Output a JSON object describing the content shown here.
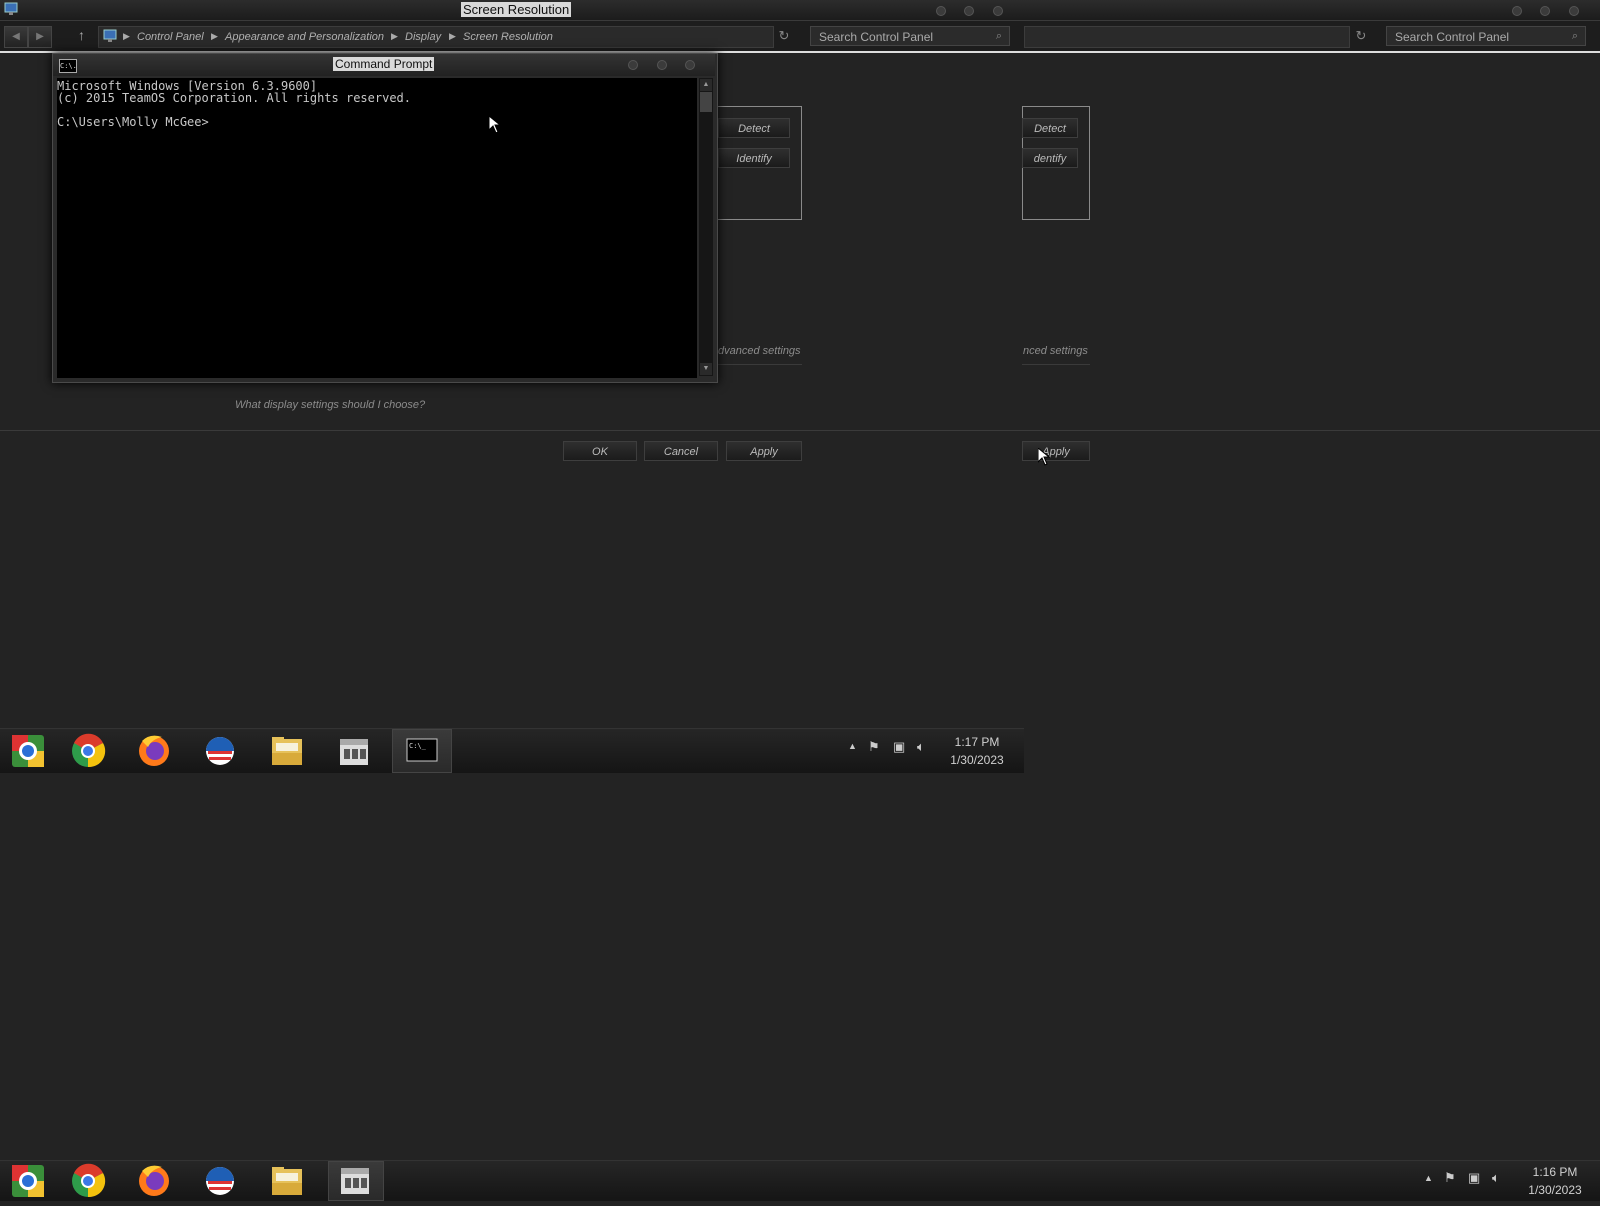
{
  "window": {
    "title": "Screen Resolution"
  },
  "nav": {
    "breadcrumbs": [
      "Control Panel",
      "Appearance and Personalization",
      "Display",
      "Screen Resolution"
    ],
    "search_placeholder": "Search Control Panel",
    "search_placeholder_right": "Search Control Panel"
  },
  "dialog": {
    "detect_label": "Detect",
    "identify_label": "Identify",
    "detect_label_right": "Detect",
    "identify_label_right": "dentify",
    "advanced_link": "dvanced settings",
    "advanced_link_right": "nced settings",
    "help_link": "What display settings should I choose?",
    "ok_label": "OK",
    "cancel_label": "Cancel",
    "apply_label": "Apply",
    "apply_label_right": "Apply"
  },
  "cmd": {
    "title": "Command Prompt",
    "icon_text": "C:\\.",
    "lines": [
      "Microsoft Windows [Version 6.3.9600]",
      "(c) 2015 TeamOS Corporation. All rights reserved.",
      "",
      "C:\\Users\\Molly McGee>"
    ]
  },
  "taskbar_upper": {
    "time": "1:17 PM",
    "date": "1/30/2023",
    "items": [
      "chrome-canary",
      "chrome",
      "firefox",
      "outlook",
      "file-explorer",
      "store",
      "command-prompt"
    ]
  },
  "taskbar_lower": {
    "time": "1:16 PM",
    "date": "1/30/2023",
    "items": [
      "chrome-canary",
      "chrome",
      "firefox",
      "outlook",
      "file-explorer",
      "store"
    ]
  },
  "colors": {
    "background": "#232323",
    "console_bg": "#000000",
    "console_text": "#c8c8c8"
  }
}
